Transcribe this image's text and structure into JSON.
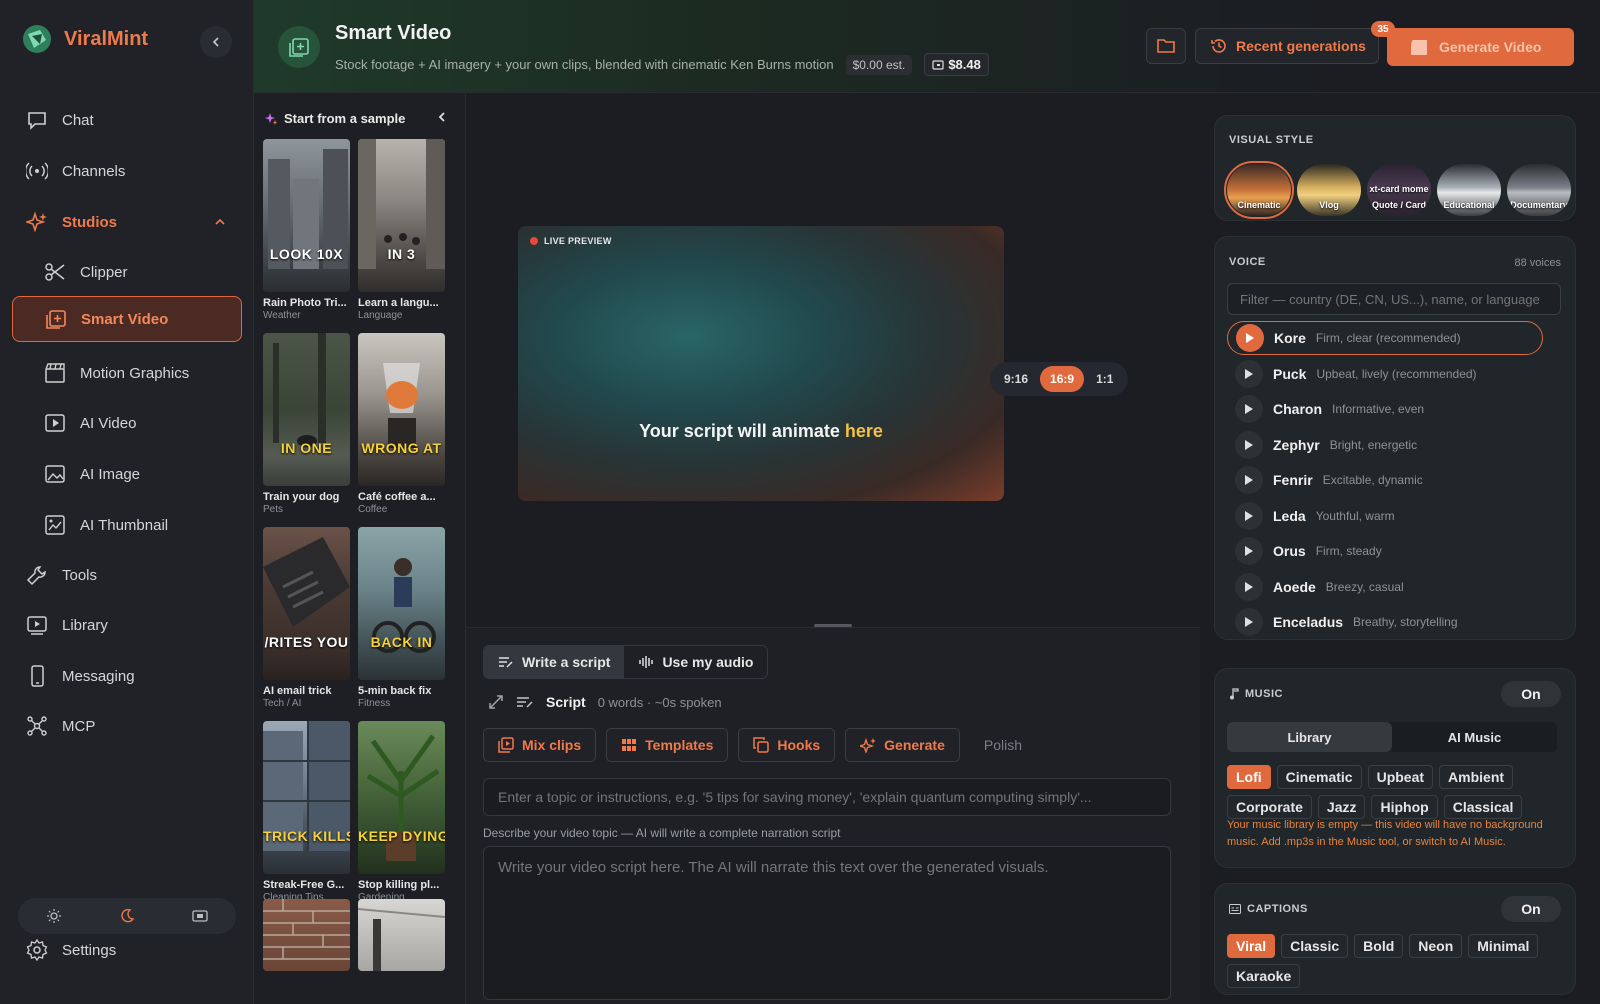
{
  "colors": {
    "accent": "#e06a3e",
    "brand": "#f07a4a",
    "highlight": "#f5c04a"
  },
  "brand": {
    "name": "ViralMint"
  },
  "sidebar": {
    "items": [
      {
        "label": "Chat",
        "icon": "chat-icon"
      },
      {
        "label": "Channels",
        "icon": "broadcast-icon"
      },
      {
        "label": "Studios",
        "icon": "sparkle-icon"
      },
      {
        "label": "Clipper",
        "icon": "scissors-icon"
      },
      {
        "label": "Smart Video",
        "icon": "smart-video-icon"
      },
      {
        "label": "Motion Graphics",
        "icon": "clapper-icon"
      },
      {
        "label": "AI Video",
        "icon": "video-icon"
      },
      {
        "label": "AI Image",
        "icon": "image-icon"
      },
      {
        "label": "AI Thumbnail",
        "icon": "thumbnail-icon"
      },
      {
        "label": "Tools",
        "icon": "wrench-icon"
      },
      {
        "label": "Library",
        "icon": "library-icon"
      },
      {
        "label": "Messaging",
        "icon": "phone-icon"
      },
      {
        "label": "MCP",
        "icon": "network-icon"
      }
    ],
    "settings_label": "Settings"
  },
  "header": {
    "title": "Smart Video",
    "subtitle": "Stock footage + AI imagery + your own clips, blended with cinematic Ken Burns motion",
    "cost_estimate": "$0.00 est.",
    "balance": "$8.48",
    "recent_label": "Recent generations",
    "recent_badge": "35",
    "generate_label": "Generate Video"
  },
  "samples": {
    "heading": "Start from a sample",
    "items": [
      {
        "caption": "LOOK 10X",
        "title": "Rain Photo Tri...",
        "category": "Weather"
      },
      {
        "caption": "IN 3",
        "title": "Learn a langu...",
        "category": "Language"
      },
      {
        "caption": "IN ONE",
        "title": "Train your dog",
        "category": "Pets"
      },
      {
        "caption": "WRONG AT",
        "title": "Café coffee a...",
        "category": "Coffee"
      },
      {
        "caption": "/RITES YOU",
        "title": "AI email trick",
        "category": "Tech / AI"
      },
      {
        "caption": "BACK IN",
        "title": "5-min back fix",
        "category": "Fitness"
      },
      {
        "caption": "TRICK KILLS",
        "title": "Streak-Free G...",
        "category": "Cleaning Tips"
      },
      {
        "caption": "KEEP DYING",
        "title": "Stop killing pl...",
        "category": "Gardening"
      },
      {
        "caption": "",
        "title": "",
        "category": ""
      },
      {
        "caption": "",
        "title": "",
        "category": ""
      }
    ]
  },
  "preview": {
    "live_label": "LIVE PREVIEW",
    "text_main": "Your script will animate ",
    "text_highlight": "here",
    "ratios": [
      "9:16",
      "16:9",
      "1:1"
    ],
    "selected_ratio": "16:9"
  },
  "editor": {
    "modes": [
      "Write a script",
      "Use my audio"
    ],
    "script_label": "Script",
    "script_meta": "0 words · ~0s spoken",
    "tools": [
      "Mix clips",
      "Templates",
      "Hooks",
      "Generate",
      "Polish"
    ],
    "topic_placeholder": "Enter a topic or instructions, e.g. '5 tips for saving money', 'explain quantum computing simply'...",
    "topic_hint": "Describe your video topic — AI will write a complete narration script",
    "script_placeholder": "Write your video script here. The AI will narrate this text over the generated visuals."
  },
  "visual_style": {
    "label": "VISUAL STYLE",
    "styles": [
      "Cinematic",
      "Vlog",
      "Quote / Card",
      "Educational",
      "Documentary"
    ],
    "quote_overlay": "xt-card mome",
    "selected": "Cinematic"
  },
  "voice": {
    "label": "VOICE",
    "count": "88 voices",
    "filter_placeholder": "Filter — country (DE, CN, US...), name, or language",
    "voices": [
      {
        "name": "Kore",
        "desc": "Firm, clear (recommended)"
      },
      {
        "name": "Puck",
        "desc": "Upbeat, lively (recommended)"
      },
      {
        "name": "Charon",
        "desc": "Informative, even"
      },
      {
        "name": "Zephyr",
        "desc": "Bright, energetic"
      },
      {
        "name": "Fenrir",
        "desc": "Excitable, dynamic"
      },
      {
        "name": "Leda",
        "desc": "Youthful, warm"
      },
      {
        "name": "Orus",
        "desc": "Firm, steady"
      },
      {
        "name": "Aoede",
        "desc": "Breezy, casual"
      },
      {
        "name": "Enceladus",
        "desc": "Breathy, storytelling"
      }
    ],
    "selected": "Kore"
  },
  "music": {
    "label": "MUSIC",
    "toggle": "On",
    "tabs": [
      "Library",
      "AI Music"
    ],
    "genres": [
      "Lofi",
      "Cinematic",
      "Upbeat",
      "Ambient",
      "Corporate",
      "Jazz",
      "Hiphop",
      "Classical"
    ],
    "selected_genre": "Lofi",
    "warning": "Your music library is empty — this video will have no background music. Add .mp3s in the Music tool, or switch to AI Music."
  },
  "captions": {
    "label": "CAPTIONS",
    "toggle": "On",
    "styles": [
      "Viral",
      "Classic",
      "Bold",
      "Neon",
      "Minimal",
      "Karaoke"
    ],
    "selected": "Viral"
  }
}
